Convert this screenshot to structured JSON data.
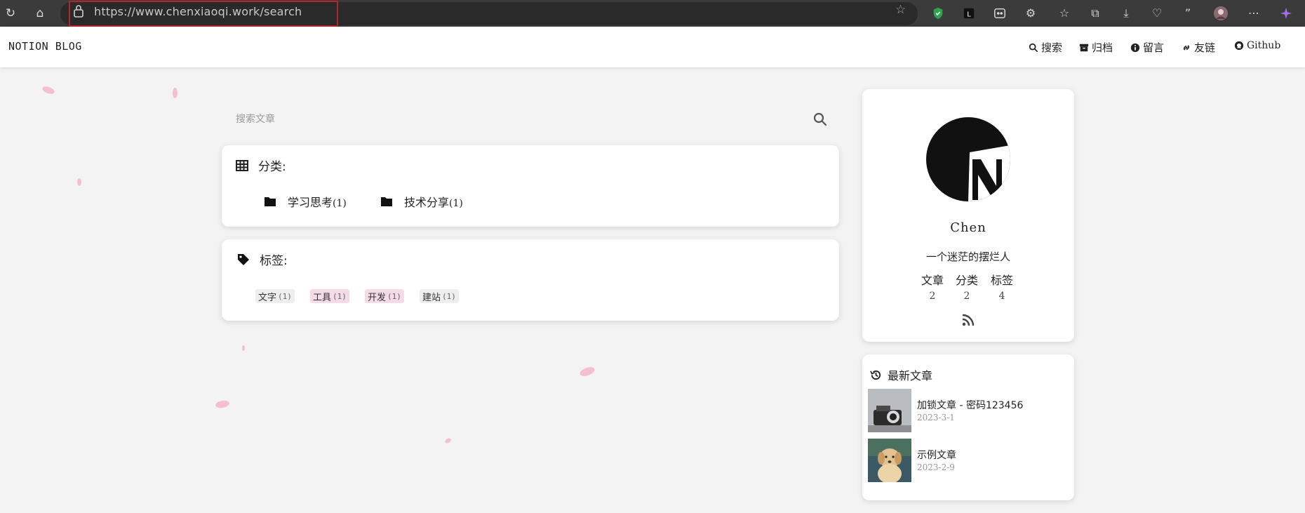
{
  "browser": {
    "url": "https://www.chenxiaoqi.work/search"
  },
  "site": {
    "brand": "NOTION BLOG",
    "nav": [
      {
        "label": "搜索",
        "icon": "search-icon"
      },
      {
        "label": "归档",
        "icon": "archive-icon"
      },
      {
        "label": "留言",
        "icon": "info-icon"
      },
      {
        "label": "友链",
        "icon": "link-icon"
      },
      {
        "label": "Github",
        "icon": "github-icon"
      }
    ]
  },
  "search": {
    "placeholder": "搜索文章"
  },
  "categories": {
    "title": "分类:",
    "items": [
      {
        "name": "学习思考",
        "count": "(1)"
      },
      {
        "name": "技术分享",
        "count": "(1)"
      }
    ]
  },
  "tags": {
    "title": "标签:",
    "items": [
      {
        "name": "文字",
        "count": "(1)",
        "color": "#eeeeee"
      },
      {
        "name": "工具",
        "count": "(1)",
        "color": "#f5dbe6"
      },
      {
        "name": "开发",
        "count": "(1)",
        "color": "#f5dbe6"
      },
      {
        "name": "建站",
        "count": "(1)",
        "color": "#eeeeee"
      }
    ]
  },
  "profile": {
    "name": "Chen",
    "bio": "一个迷茫的摆烂人",
    "stats": [
      {
        "label": "文章",
        "value": "2"
      },
      {
        "label": "分类",
        "value": "2"
      },
      {
        "label": "标签",
        "value": "4"
      }
    ]
  },
  "latest": {
    "title": "最新文章",
    "posts": [
      {
        "title": "加锁文章 - 密码123456",
        "date": "2023-3-1"
      },
      {
        "title": "示例文章",
        "date": "2023-2-9"
      }
    ]
  }
}
